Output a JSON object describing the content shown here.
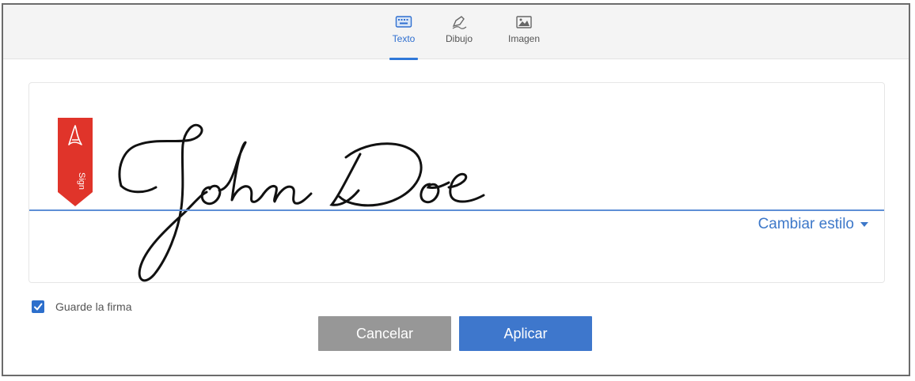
{
  "tabs": [
    {
      "label": "Texto",
      "icon": "keyboard-icon",
      "active": true
    },
    {
      "label": "Dibujo",
      "icon": "pen-draw-icon",
      "active": false
    },
    {
      "label": "Imagen",
      "icon": "image-icon",
      "active": false
    }
  ],
  "signature": {
    "text": "John Doe",
    "tag_label": "Sign",
    "change_style_label": "Cambiar estilo"
  },
  "save_signature": {
    "label": "Guarde la firma",
    "checked": true
  },
  "buttons": {
    "cancel_label": "Cancelar",
    "apply_label": "Aplicar"
  },
  "colors": {
    "accent": "#2f78d8",
    "apply_button": "#3e77cc",
    "cancel_button": "#979797",
    "sign_tag": "#e0342a"
  }
}
